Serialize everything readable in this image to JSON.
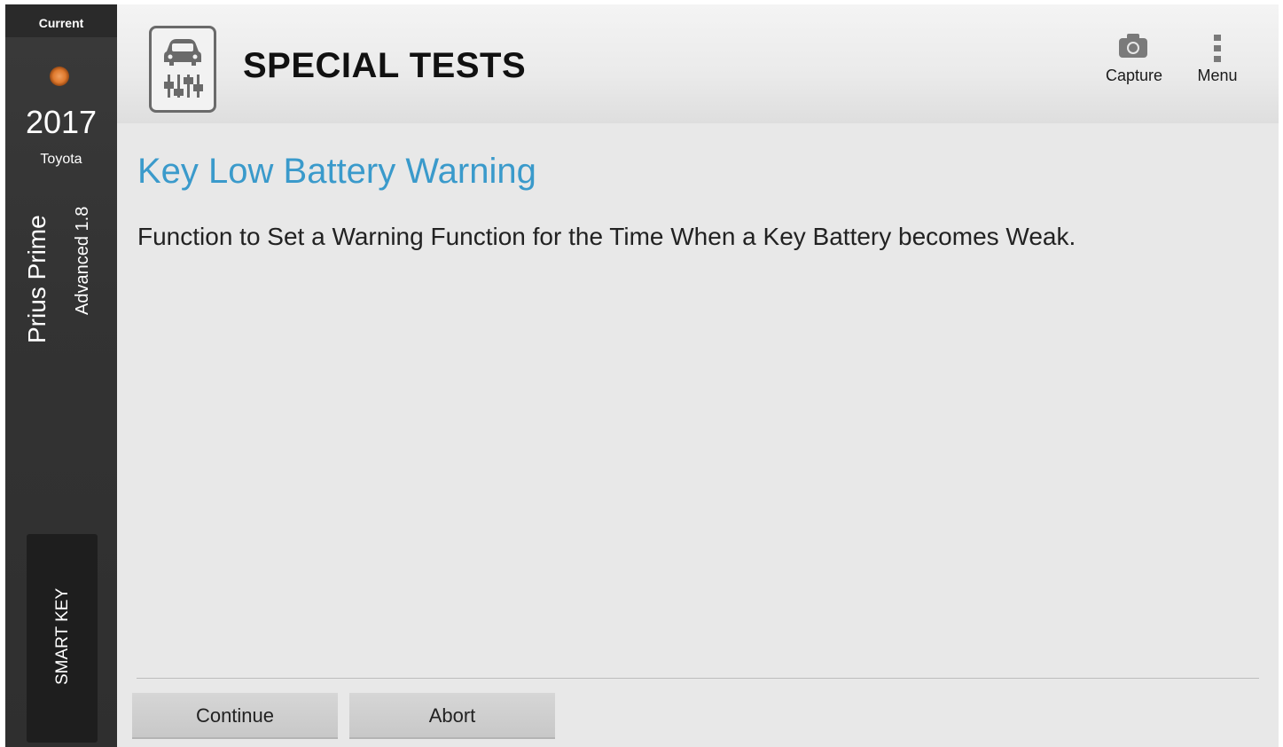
{
  "sidebar": {
    "current_label": "Current",
    "year": "2017",
    "make": "Toyota",
    "model": "Prius Prime",
    "submodel": "Advanced 1.8",
    "system_tab_label": "SMART KEY",
    "status_color": "#e07a2e"
  },
  "header": {
    "title": "SPECIAL TESTS",
    "app_icon": "car-test-icon",
    "capture_label": "Capture",
    "menu_label": "Menu"
  },
  "main": {
    "section_title": "Key Low Battery Warning",
    "description": "Function to Set a Warning Function for the Time When a Key Battery becomes Weak.",
    "accent_color": "#3a9acb"
  },
  "footer": {
    "continue_label": "Continue",
    "abort_label": "Abort"
  }
}
